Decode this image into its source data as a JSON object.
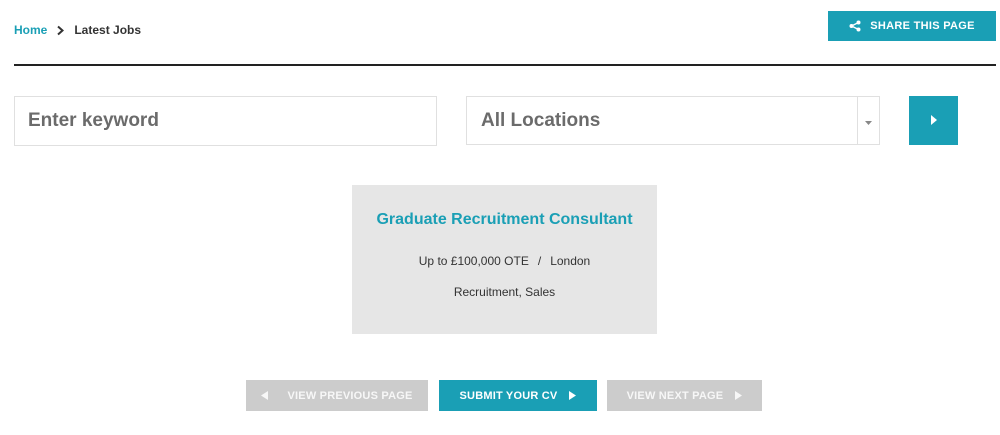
{
  "breadcrumb": {
    "home_label": "Home",
    "current_label": "Latest Jobs"
  },
  "header": {
    "share_label": "SHARE THIS PAGE",
    "share_icon": "share-icon"
  },
  "search": {
    "keyword_placeholder": "Enter keyword",
    "keyword_value": "",
    "location_selected": "All Locations",
    "submit_icon": "chevron-right-icon"
  },
  "jobs": [
    {
      "title": "Graduate Recruitment Consultant",
      "salary": "Up to £100,000 OTE",
      "separator": "/",
      "location": "London",
      "categories": "Recruitment, Sales"
    }
  ],
  "pagination": {
    "prev_label": "VIEW PREVIOUS PAGE",
    "submit_cv_label": "SUBMIT YOUR CV",
    "next_label": "VIEW NEXT PAGE"
  },
  "colors": {
    "accent": "#1a9fb5",
    "card_bg": "#e6e6e6",
    "disabled_btn": "#cccccc",
    "divider": "#222222"
  }
}
